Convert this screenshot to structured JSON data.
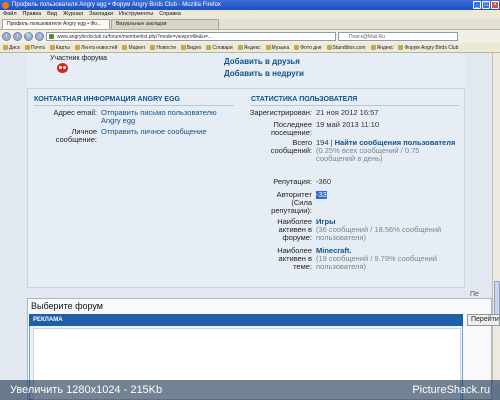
{
  "window": {
    "title": "Профиль пользователя Angry egg • Форум Angry Birds Club - Mozilla Firefox"
  },
  "menu": [
    "Файл",
    "Правка",
    "Вид",
    "Журнал",
    "Закладки",
    "Инструменты",
    "Справка"
  ],
  "tabs": [
    {
      "label": "Профиль пользователя Angry egg • Фо..."
    },
    {
      "label": "Визуальные закладки"
    }
  ],
  "nav": {
    "url": "www.angrybirdsclub.ru/forum/memberlist.php?mode=viewprofile&u=...",
    "search_placeholder": "Поиск@Mail.Ru"
  },
  "bookmarks": [
    "Диск",
    "Почта",
    "Карты",
    "Лента новостей",
    "Маркет",
    "Новости",
    "Видео",
    "Словари",
    "Яндекс",
    "Музыка",
    "Фото дня",
    "Standblox.com",
    "Яндекс",
    "Форум Angry Birds Club"
  ],
  "profile": {
    "rank": "Участник форума",
    "add_friends": "Добавить в друзья",
    "add_foes": "Добавить в недруги"
  },
  "contact": {
    "heading": "КОНТАКТНАЯ ИНФОРМАЦИЯ ANGRY EGG",
    "email_label": "Адрес email:",
    "email_value": "Отправить письмо пользователю Angry egg",
    "pm_label": "Личное сообщение:",
    "pm_value": "Отправить личное сообщение"
  },
  "stats": {
    "heading": "СТАТИСТИКА ПОЛЬЗОВАТЕЛЯ",
    "registered_label": "Зарегистрирован:",
    "registered_value": "21 ноя 2012 16:57",
    "last_visit_label": "Последнее посещение:",
    "last_visit_value": "19 май 2013 11:10",
    "total_posts_label": "Всего сообщений:",
    "total_posts_value": "194",
    "find_posts": "Найти сообщения пользователя",
    "posts_note": "(0.25% всех сообщений / 0.75 сообщений в день)",
    "reputation_label": "Репутация:",
    "reputation_value": "-360",
    "authority_label": "Авторитет (Сила репутации):",
    "authority_value": "-33",
    "active_forum_label": "Наиболее активен в форуме:",
    "active_forum_value": "Игры",
    "active_forum_note": "(36 сообщений / 18.56% сообщений пользователя)",
    "active_topic_label": "Наиболее активен в теме:",
    "active_topic_value": "Minecraft.",
    "active_topic_note": "(19 сообщений / 9.79% сообщений пользователя)"
  },
  "misc": {
    "nav_arrow": "Перейти"
  },
  "jump": {
    "title": "Выберите форум",
    "ad_label": "РЕКЛАМА",
    "go_label": "Перейти"
  },
  "watermark": {
    "left": "Увеличить 1280x1024 - 215Kb",
    "right": "PictureShack.ru"
  }
}
